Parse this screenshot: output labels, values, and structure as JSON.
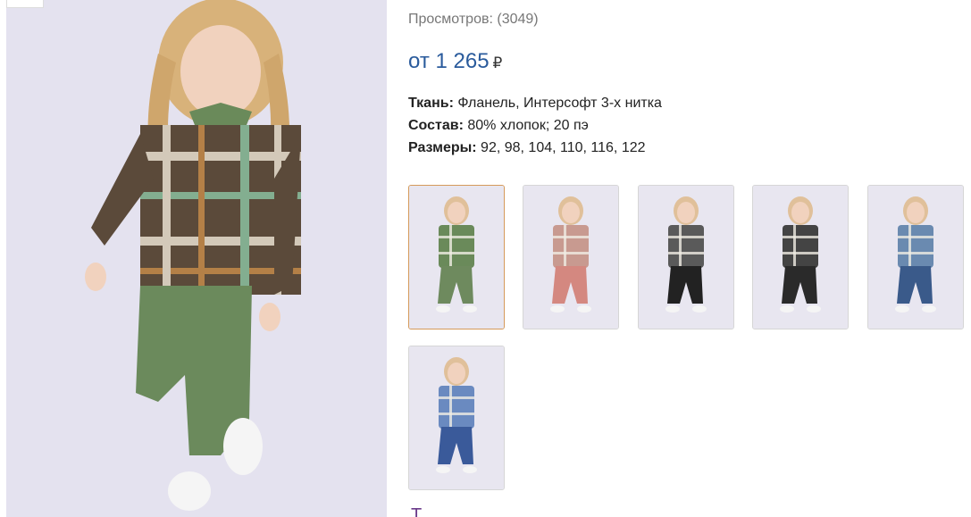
{
  "product": {
    "views_label": "Просмотров: (3049)",
    "price_prefix": "от 1 265",
    "currency": "₽",
    "price_color": "#2a5b9c",
    "props": [
      {
        "label": "Ткань:",
        "value": " Фланель, Интерсофт 3-х нитка"
      },
      {
        "label": "Состав:",
        "value": " 80% хлопок; 20 пэ"
      },
      {
        "label": "Размеры:",
        "value": " 92, 98, 104, 110, 116, 122"
      }
    ]
  },
  "thumbnails": [
    {
      "name": "thumb-green-plaid",
      "shirt": "#6a8a5a",
      "pants": "#6e8a5e",
      "active": true
    },
    {
      "name": "thumb-pink-plaid",
      "shirt": "#c89a90",
      "pants": "#d48880",
      "active": false
    },
    {
      "name": "thumb-black-white-plaid",
      "shirt": "#5a5a5a",
      "pants": "#222222",
      "active": false
    },
    {
      "name": "thumb-boy-black-plaid",
      "shirt": "#444444",
      "pants": "#2a2a2a",
      "active": false
    },
    {
      "name": "thumb-boy-blue-plaid",
      "shirt": "#6a8ab0",
      "pants": "#3a5a8a",
      "active": false
    },
    {
      "name": "thumb-blue-plaid",
      "shirt": "#6a8ac0",
      "pants": "#3a5a9a",
      "active": false
    }
  ],
  "next_heading": "Т..."
}
